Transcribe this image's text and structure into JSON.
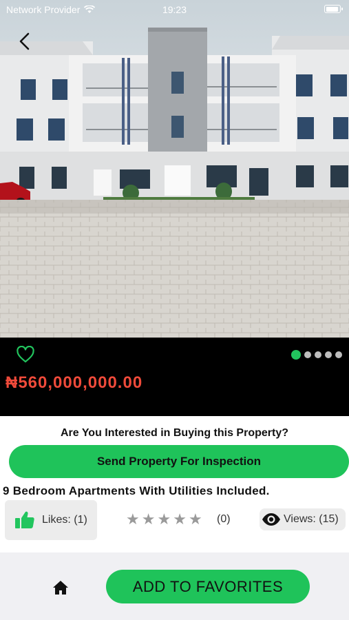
{
  "status_bar": {
    "carrier": "Network Provider",
    "time": "19:23",
    "battery_level": 0.9
  },
  "icons": {
    "back": "chevron-left-icon",
    "favorite": "heart-outline-icon",
    "like": "thumbs-up-icon",
    "views": "eye-icon",
    "home": "home-icon",
    "rating": "star-icon"
  },
  "gallery": {
    "image_count": 5,
    "active_index": 0
  },
  "property": {
    "price": "₦560,000,000.00",
    "title": "9 Bedroom Apartments With Utilities Included."
  },
  "inspection": {
    "question": "Are You Interested in Buying this Property?",
    "button_label": "Send Property For Inspection"
  },
  "stats": {
    "likes_label": "Likes: (1)",
    "rating_stars": 5,
    "rating_count": "(0)",
    "views_label": "Views: (15)"
  },
  "footer": {
    "favorites_label": "ADD TO FAVORITES"
  },
  "colors": {
    "accent": "#1fc35a",
    "price": "#ef4a3a",
    "band": "#000000"
  }
}
